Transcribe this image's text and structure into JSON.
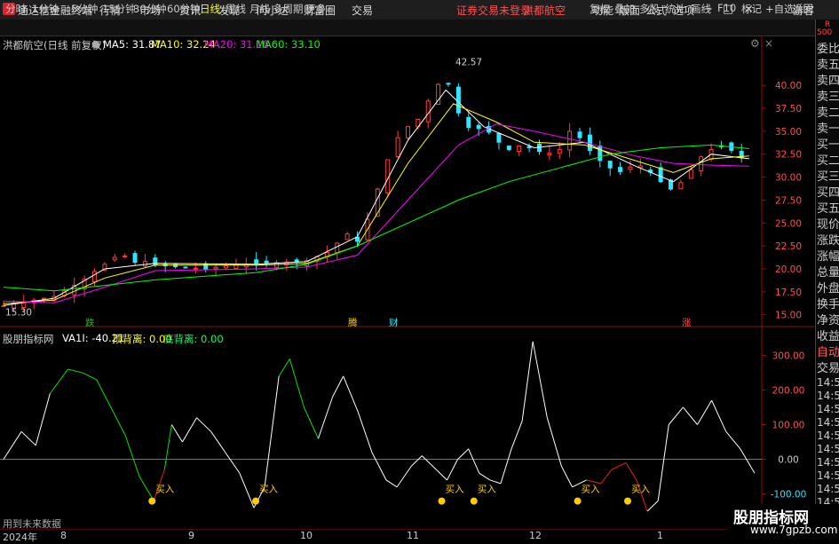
{
  "app": {
    "title": "通达信金融终端",
    "login_notice": "证券交易未登录",
    "stock_title": "洪都航空",
    "menu": [
      "行情",
      "市场",
      "资讯",
      "发现",
      "问小达",
      "财富圈",
      "交易"
    ],
    "right_menu": [
      "功能",
      "版面",
      "公式",
      "选项"
    ],
    "guest": "游客",
    "win_buttons": [
      "−",
      "□",
      "×"
    ]
  },
  "toolbar": {
    "periods": [
      "分时",
      "1分钟",
      "5分钟",
      "15分钟",
      "30分钟",
      "60分钟",
      "日线",
      "周线",
      "月线",
      "多周期",
      "更多"
    ],
    "active_period": "日线",
    "buttons": [
      "复权",
      "叠加",
      "多股",
      "统计",
      "画线",
      "F10",
      "标记",
      "+自选",
      "返回"
    ]
  },
  "icons": {
    "logo": "app-logo-icon",
    "settings": "settings-icon",
    "close": "close-icon"
  },
  "colors": {
    "up": "#ff3c3c",
    "down": "#2ee6ff",
    "ma5": "#ffffff",
    "ma10": "#ffff00",
    "ma20": "#ff00ff",
    "ma60": "#00ff00",
    "zero": "#1fae1f",
    "signal": "#ffcc00"
  },
  "price_panel": {
    "stock_label": "洪都航空(日线 前复权)",
    "ma5": "MA5: 31.87",
    "ma10": "MA10: 32.24",
    "ma20": "MA20: 31.16",
    "ma60": "MA60: 33.10",
    "high_label": "42.57",
    "low_label": "15.30",
    "markers": [
      "跌",
      "腾",
      "财",
      "涨"
    ]
  },
  "indicator_panel": {
    "name": "股朋指标网",
    "va1": "VA1I: -40.21",
    "top_label": "顶背离: 0.00",
    "bottom_label": "底背离: 0.00",
    "buy_label": "买入",
    "no_data": "用到未来数据"
  },
  "side_panel": {
    "items": [
      "委比",
      "卖五",
      "卖四",
      "卖三",
      "卖二",
      "卖一",
      "买一",
      "买二",
      "买三",
      "买四",
      "买五",
      "现价",
      "涨跌",
      "涨幅",
      "总量",
      "外盘",
      "换手",
      "净资",
      "收益"
    ],
    "r_label": "R",
    "r_value": "500",
    "auto": "自动",
    "trade": "交易",
    "times": [
      "14:56",
      "14:56",
      "14:56",
      "14:56",
      "14:56",
      "14:56",
      "14:56",
      "14:56",
      "14:56",
      "14:56",
      "14:56"
    ]
  },
  "date_axis": {
    "labels": [
      "2024年",
      "8",
      "9",
      "10",
      "11",
      "12",
      "1"
    ]
  },
  "watermark": {
    "title": "股朋指标网",
    "url": "www.7gpzb.com"
  },
  "chart_data": [
    {
      "type": "candlestick",
      "title": "洪都航空(日线 前复权)",
      "y_ticks": [
        15.0,
        17.5,
        20.0,
        22.5,
        25.0,
        27.5,
        30.0,
        32.5,
        35.0,
        37.5,
        40.0
      ],
      "ylim": [
        14.0,
        43.5
      ],
      "close_points": [
        [
          0,
          16.0
        ],
        [
          10,
          16.5
        ],
        [
          20,
          17.0
        ],
        [
          30,
          18.5
        ],
        [
          40,
          20.5
        ],
        [
          47,
          21.8
        ],
        [
          50,
          20.6
        ],
        [
          55,
          20.9
        ],
        [
          60,
          20.4
        ],
        [
          70,
          20.2
        ],
        [
          80,
          20.0
        ],
        [
          90,
          20.4
        ],
        [
          100,
          20.6
        ],
        [
          110,
          20.7
        ],
        [
          120,
          20.9
        ],
        [
          130,
          22.0
        ],
        [
          135,
          24.0
        ],
        [
          140,
          23.0
        ],
        [
          145,
          26.0
        ],
        [
          150,
          30.5
        ],
        [
          155,
          34.0
        ],
        [
          160,
          35.5
        ],
        [
          165,
          36.5
        ],
        [
          170,
          39.5
        ],
        [
          175,
          41.0
        ],
        [
          180,
          37.0
        ],
        [
          185,
          35.0
        ],
        [
          190,
          35.5
        ],
        [
          195,
          34.0
        ],
        [
          200,
          33.0
        ],
        [
          205,
          33.5
        ],
        [
          210,
          33.0
        ],
        [
          215,
          32.5
        ],
        [
          220,
          33.0
        ],
        [
          225,
          35.5
        ],
        [
          230,
          33.5
        ],
        [
          235,
          32.0
        ],
        [
          240,
          31.0
        ],
        [
          245,
          30.5
        ],
        [
          250,
          31.5
        ],
        [
          255,
          30.8
        ],
        [
          260,
          29.5
        ],
        [
          265,
          28.5
        ],
        [
          270,
          30.0
        ],
        [
          275,
          32.0
        ],
        [
          280,
          33.0
        ],
        [
          285,
          33.5
        ],
        [
          290,
          32.5
        ],
        [
          295,
          31.5
        ]
      ],
      "ma_series": {
        "MA5": [
          [
            0,
            16.0
          ],
          [
            20,
            16.8
          ],
          [
            40,
            20.0
          ],
          [
            60,
            20.6
          ],
          [
            100,
            20.5
          ],
          [
            120,
            20.8
          ],
          [
            140,
            23.5
          ],
          [
            160,
            34.0
          ],
          [
            175,
            39.5
          ],
          [
            190,
            35.5
          ],
          [
            210,
            33.2
          ],
          [
            230,
            33.8
          ],
          [
            250,
            31.2
          ],
          [
            265,
            29.5
          ],
          [
            280,
            32.5
          ],
          [
            295,
            32.0
          ]
        ],
        "MA10": [
          [
            0,
            16.2
          ],
          [
            20,
            16.6
          ],
          [
            40,
            19.0
          ],
          [
            60,
            20.4
          ],
          [
            100,
            20.4
          ],
          [
            120,
            20.6
          ],
          [
            140,
            22.5
          ],
          [
            160,
            31.5
          ],
          [
            178,
            38.0
          ],
          [
            195,
            36.0
          ],
          [
            210,
            33.8
          ],
          [
            230,
            33.5
          ],
          [
            250,
            31.8
          ],
          [
            265,
            30.5
          ],
          [
            280,
            32.0
          ],
          [
            295,
            32.3
          ]
        ],
        "MA20": [
          [
            0,
            16.5
          ],
          [
            20,
            16.3
          ],
          [
            40,
            18.0
          ],
          [
            60,
            19.8
          ],
          [
            100,
            20.0
          ],
          [
            120,
            20.2
          ],
          [
            140,
            21.5
          ],
          [
            160,
            27.5
          ],
          [
            180,
            33.5
          ],
          [
            195,
            35.8
          ],
          [
            210,
            35.0
          ],
          [
            230,
            33.8
          ],
          [
            250,
            32.3
          ],
          [
            265,
            31.5
          ],
          [
            280,
            31.3
          ],
          [
            295,
            31.2
          ]
        ],
        "MA60": [
          [
            0,
            18.0
          ],
          [
            20,
            17.6
          ],
          [
            40,
            18.2
          ],
          [
            60,
            18.8
          ],
          [
            100,
            19.6
          ],
          [
            120,
            20.5
          ],
          [
            140,
            22.5
          ],
          [
            160,
            25.0
          ],
          [
            180,
            27.5
          ],
          [
            200,
            29.5
          ],
          [
            220,
            31.0
          ],
          [
            240,
            32.5
          ],
          [
            260,
            33.2
          ],
          [
            280,
            33.5
          ],
          [
            295,
            33.1
          ]
        ]
      }
    },
    {
      "type": "line",
      "title": "股朋指标网",
      "y_ticks": [
        -100.0,
        0.0,
        100.0,
        200.0,
        300.0
      ],
      "ylim": [
        -160,
        360
      ],
      "series": [
        {
          "name": "VA1I",
          "points": [
            [
              0,
              0
            ],
            [
              5,
              80
            ],
            [
              9,
              40
            ],
            [
              13,
              190
            ],
            [
              18,
              260
            ],
            [
              22,
              250
            ],
            [
              26,
              230
            ],
            [
              30,
              150
            ],
            [
              34,
              70
            ],
            [
              38,
              -50
            ],
            [
              42,
              -120
            ],
            [
              45,
              -30
            ],
            [
              47,
              100
            ],
            [
              50,
              50
            ],
            [
              54,
              120
            ],
            [
              58,
              80
            ],
            [
              62,
              20
            ],
            [
              66,
              -40
            ],
            [
              70,
              -140
            ],
            [
              73,
              -80
            ],
            [
              77,
              240
            ],
            [
              80,
              290
            ],
            [
              84,
              150
            ],
            [
              88,
              60
            ],
            [
              92,
              180
            ],
            [
              95,
              240
            ],
            [
              99,
              140
            ],
            [
              103,
              20
            ],
            [
              107,
              -60
            ],
            [
              110,
              -80
            ],
            [
              114,
              -20
            ],
            [
              117,
              10
            ],
            [
              121,
              -30
            ],
            [
              124,
              -60
            ],
            [
              127,
              0
            ],
            [
              130,
              30
            ],
            [
              133,
              -40
            ],
            [
              136,
              -60
            ],
            [
              139,
              -70
            ],
            [
              142,
              30
            ],
            [
              145,
              110
            ],
            [
              148,
              340
            ],
            [
              152,
              120
            ],
            [
              156,
              -20
            ],
            [
              159,
              -80
            ],
            [
              163,
              -60
            ],
            [
              167,
              -70
            ],
            [
              170,
              -30
            ],
            [
              174,
              -10
            ],
            [
              177,
              -60
            ],
            [
              180,
              -150
            ],
            [
              183,
              -120
            ],
            [
              186,
              100
            ],
            [
              190,
              150
            ],
            [
              194,
              100
            ],
            [
              198,
              170
            ],
            [
              202,
              80
            ],
            [
              206,
              30
            ],
            [
              210,
              -40
            ]
          ],
          "green_ranges": [
            [
              13,
              47
            ],
            [
              77,
              88
            ]
          ],
          "red_ranges": [
            [
              40,
              45
            ],
            [
              163,
              180
            ]
          ]
        }
      ],
      "buy_signals": [
        43,
        72,
        124,
        133,
        162,
        176
      ]
    }
  ]
}
